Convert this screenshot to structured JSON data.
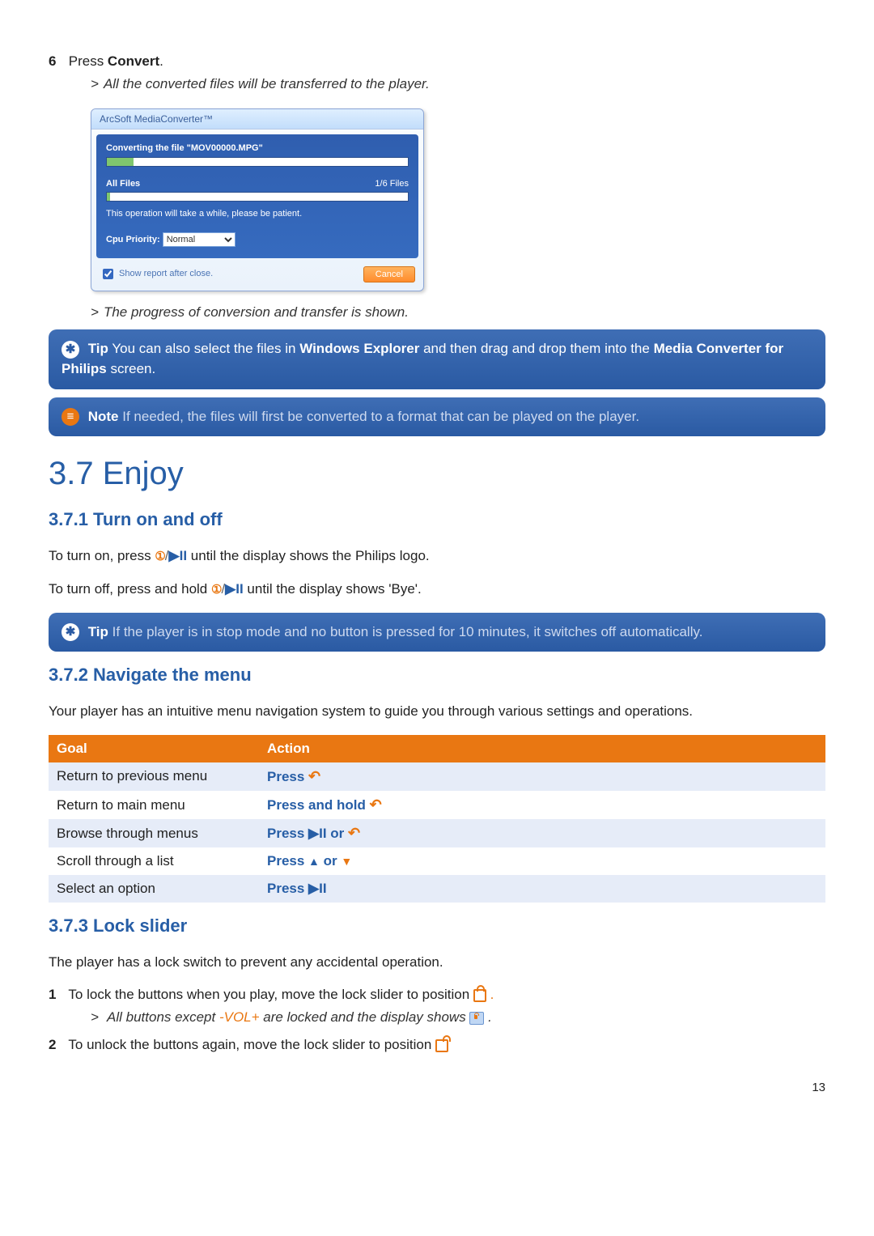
{
  "step6": {
    "num": "6",
    "text_prefix": "Press ",
    "text_bold": "Convert",
    "text_suffix": ".",
    "result": "All the converted files will be transferred to the player."
  },
  "dialog": {
    "title": "ArcSoft MediaConverter™",
    "converting_label": "Converting the file \"MOV00000.MPG\"",
    "pct1": "9%",
    "all_files_label": "All Files",
    "files_count": "1/6 Files",
    "pct2": "1%",
    "patience": "This operation will take a while, please be patient.",
    "cpu_label": "Cpu Priority:",
    "cpu_value": "Normal",
    "show_report": "Show report after close.",
    "cancel": "Cancel"
  },
  "progress_line": "The progress of conversion and transfer is shown.",
  "tip1_label": "Tip",
  "tip1_a": " You can also select the files in ",
  "tip1_b": "Windows Explorer",
  "tip1_c": " and then drag and drop them into the ",
  "tip1_d": "Media Converter for Philips",
  "tip1_e": " screen.",
  "note_label": "Note",
  "note_text": " If needed, the files will first be converted to a format that can be played on the player.",
  "h_main": "3.7  Enjoy",
  "h_371": "3.7.1  Turn on and off",
  "turn_on_a": "To turn on, press ",
  "turn_on_b": " until the display shows the Philips logo.",
  "turn_off_a": "To turn off, press and hold ",
  "turn_off_b": " until the display shows 'Bye'.",
  "tip2_label": "Tip",
  "tip2_text": " If the player is in stop mode and no button is pressed for 10 minutes, it switches off automatically.",
  "h_372": "3.7.2  Navigate the menu",
  "nav_intro": "Your player has an intuitive menu navigation system to guide you through various settings and operations.",
  "nav_table": {
    "head_goal": "Goal",
    "head_action": "Action",
    "rows": [
      {
        "goal": "Return to previous menu",
        "action_prefix": "Press ",
        "icon": "back"
      },
      {
        "goal": "Return to main menu",
        "action_prefix": "Press and hold ",
        "icon": "back"
      },
      {
        "goal": "Browse through menus",
        "action_prefix": "Press ",
        "icon": "play_or_back"
      },
      {
        "goal": "Scroll through a list",
        "action_prefix": "Press ",
        "icon": "updown"
      },
      {
        "goal": "Select an option",
        "action_prefix": "Press ",
        "icon": "play"
      }
    ]
  },
  "h_373": "3.7.3  Lock slider",
  "lock_intro": "The player has a lock switch to prevent any accidental operation.",
  "lock_step1_num": "1",
  "lock_step1_text": "To lock the buttons when you play, move the lock slider to position ",
  "lock_step1_res_a": "All buttons except ",
  "lock_step1_res_vol": "-VOL+",
  "lock_step1_res_b": " are locked and the display shows ",
  "lock_step2_num": "2",
  "lock_step2_text": "To unlock the buttons again, move the lock slider to position ",
  "page_number": "13"
}
